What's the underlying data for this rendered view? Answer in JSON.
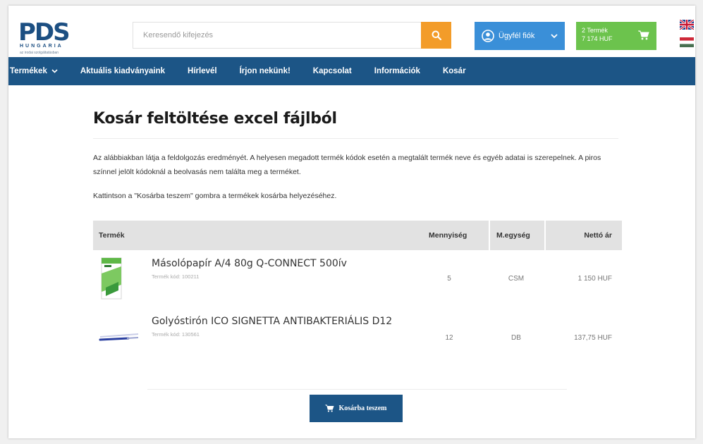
{
  "header": {
    "logo_text": "PDS",
    "logo_sub": "HUNGARIA",
    "logo_tagline": "az irodai szolgáltatásban",
    "search_placeholder": "Keresendő kifejezés",
    "account_label": "Ügyfél fiók",
    "cart_line1": "2 Termék",
    "cart_line2": "7 174 HUF"
  },
  "nav": {
    "items": [
      "Termékek",
      "Aktuális kiadványaink",
      "Hírlevél",
      "Írjon nekünk!",
      "Kapcsolat",
      "Információk",
      "Kosár"
    ]
  },
  "main": {
    "title": "Kosár feltöltése excel fájlból",
    "paragraph": "Az alábbiakban látja a feldolgozás eredményét. A helyesen megadott termék kódok esetén a megtalált termék neve és egyéb adatai is szerepelnek. A piros színnel jelölt kódoknál a beolvasás nem találta meg a terméket.",
    "instruction": "Kattintson a \"Kosárba teszem\" gombra a termékek kosárba helyezéséhez.",
    "add_button": "Kosárba teszem"
  },
  "table": {
    "headers": {
      "product": "Termék",
      "qty": "Mennyiség",
      "unit": "M.egység",
      "price": "Nettó ár"
    },
    "rows": [
      {
        "name": "Másolópapír A/4 80g Q-CONNECT 500ív",
        "code": "Termék kód: 100211",
        "qty": "5",
        "unit": "CSM",
        "price": "1 150 HUF"
      },
      {
        "name": "Golyóstirón ICO SIGNETTA ANTIBAKTERIÁLIS D12",
        "code": "Termék kód: 130561",
        "qty": "12",
        "unit": "DB",
        "price": "137,75 HUF"
      }
    ]
  },
  "colors": {
    "nav_bg": "#1c5586",
    "search_button": "#f39c29",
    "account_button": "#3a8fd8",
    "cart_button": "#6cc34d"
  },
  "icons": [
    "search-icon",
    "user-icon",
    "chevron-down-icon",
    "cart-icon",
    "uk-flag-icon",
    "hu-flag-icon"
  ]
}
